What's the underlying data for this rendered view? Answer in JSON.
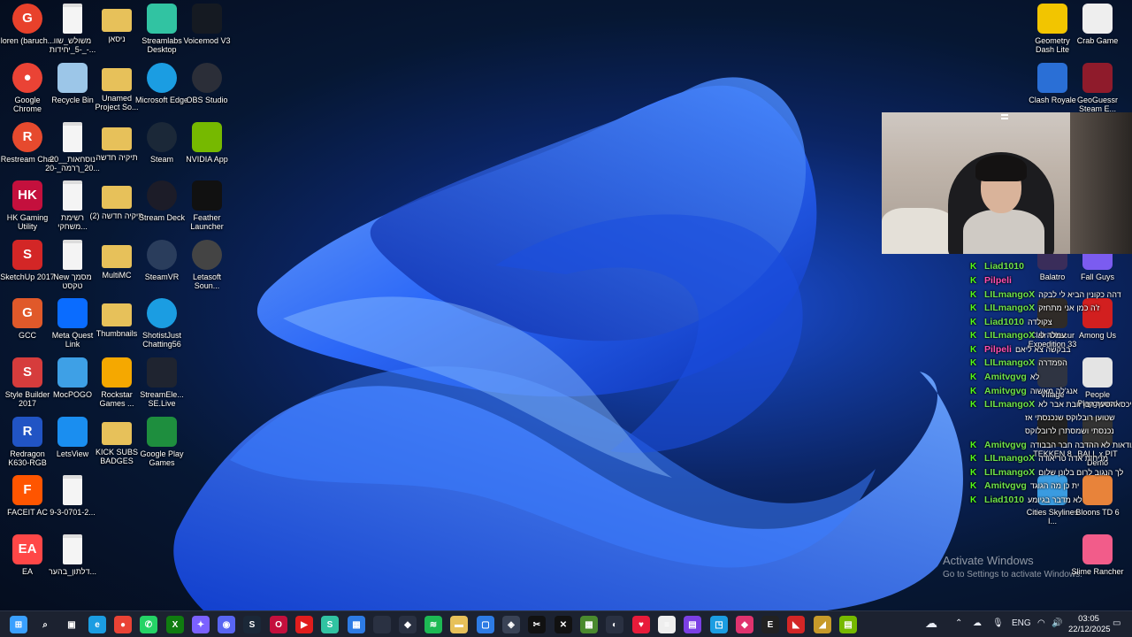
{
  "desktop_icons": [
    {
      "label": "loren (baruch...",
      "color": "#e8412b"
    },
    {
      "label": "Google Chrome",
      "color": "#ea4335"
    },
    {
      "label": "Restream Chat",
      "color": "#e64a2e"
    },
    {
      "label": "HK Gaming Utility",
      "color": "#c4103d"
    },
    {
      "label": "SketchUp 2017",
      "color": "#d32626"
    },
    {
      "label": "GCC",
      "color": "#e0592a"
    },
    {
      "label": "Style Builder 2017",
      "color": "#d63c3c"
    },
    {
      "label": "Redragon K630-RGB",
      "color": "#2154c4"
    },
    {
      "label": "FACEIT AC",
      "color": "#ff5500"
    },
    {
      "label": "EA",
      "color": "#ff4747"
    },
    {
      "label": "משולש_שוו -5_יחידות_-...",
      "color": "#f4f4f4"
    },
    {
      "label": "Recycle Bin",
      "color": "#9cc6e8"
    },
    {
      "label": "20_נוסחאות_ 20_ךרמה_-20...",
      "color": "#f4f4f4"
    },
    {
      "label": "רשימת משחקי...",
      "color": "#f4f4f4"
    },
    {
      "label": "New מסמך טקסט",
      "color": "#f4f4f4"
    },
    {
      "label": "Meta Quest Link",
      "color": "#0a6cff"
    },
    {
      "label": "MocPOGO",
      "color": "#3ea0e6"
    },
    {
      "label": "LetsView",
      "color": "#1a8ef0"
    },
    {
      "label": "9-3-0701-2...",
      "color": "#f4f4f4"
    },
    {
      "label": "דלתון_בהער...",
      "color": "#f4f4f4"
    },
    {
      "label": "ניסאן",
      "color": "#e7c15a"
    },
    {
      "label": "Unamed Project So...",
      "color": "#e7c15a"
    },
    {
      "label": "תיקיה חדשה",
      "color": "#e7c15a"
    },
    {
      "label": "תיקיה חדשה (2)",
      "color": "#e7c15a"
    },
    {
      "label": "MultiMC",
      "color": "#e7c15a"
    },
    {
      "label": "Thumbnails",
      "color": "#e7c15a"
    },
    {
      "label": "Rockstar Games ...",
      "color": "#f5a800"
    },
    {
      "label": "KICK SUBS BADGES",
      "color": "#e7c15a"
    },
    {
      "label": "Streamlabs Desktop",
      "color": "#31c3a2"
    },
    {
      "label": "Microsoft Edge",
      "color": "#1b9de2"
    },
    {
      "label": "Steam",
      "color": "#1b2838"
    },
    {
      "label": "Stream Deck",
      "color": "#1c1c28"
    },
    {
      "label": "SteamVR",
      "color": "#2a3d5c"
    },
    {
      "label": "ShotistJust Chatting56",
      "color": "#1b9de2"
    },
    {
      "label": "StreamEle... SE.Live",
      "color": "#1f2430"
    },
    {
      "label": "Google Play Games",
      "color": "#1e8e3e"
    },
    {
      "label": "Voicemod V3",
      "color": "#151a22"
    },
    {
      "label": "OBS Studio",
      "color": "#2b2e38"
    },
    {
      "label": "NVIDIA App",
      "color": "#76b900"
    },
    {
      "label": "Feather Launcher",
      "color": "#111111"
    },
    {
      "label": "Letasoft Soun...",
      "color": "#444444"
    },
    {
      "label": "Geometry Dash Lite",
      "color": "#f2c500"
    },
    {
      "label": "Crab Game",
      "color": "#eeeeee"
    },
    {
      "label": "Clash Royale",
      "color": "#2a6fd6"
    },
    {
      "label": "GeoGuessr Steam E...",
      "color": "#8f1b2b"
    },
    {
      "label": "Balatro",
      "color": "#3a2d5a"
    },
    {
      "label": "Fall Guys",
      "color": "#7b5cf0"
    },
    {
      "label": "Clair Obscur Expedition 33",
      "color": "#2f2b28"
    },
    {
      "label": "Among Us",
      "color": "#d21f1f"
    },
    {
      "label": "Village",
      "color": "#2f3442"
    },
    {
      "label": "People Playground",
      "color": "#e4e4e4"
    },
    {
      "label": "TEKKEN 8",
      "color": "#222222"
    },
    {
      "label": "BALL x PIT Demo",
      "color": "#333333"
    },
    {
      "label": "Cities Skylines I...",
      "color": "#3a9be0"
    },
    {
      "label": "Bloons TD 6",
      "color": "#e8833a"
    },
    {
      "label": "Slime Rancher",
      "color": "#f25c8a"
    }
  ],
  "icon_glyphs": {
    "loren (baruch...": "G",
    "Google Chrome": "●",
    "Restream Chat": "R",
    "HK Gaming Utility": "HK",
    "SketchUp 2017": "S",
    "GCC": "G",
    "Style Builder 2017": "S",
    "Redragon K630-RGB": "R",
    "FACEIT AC": "F",
    "EA": "EA"
  },
  "chat": {
    "messages": [
      {
        "user": "Liad1010",
        "text": ""
      },
      {
        "user": "Pilpeli",
        "text": ""
      },
      {
        "user": "LILmangoX",
        "text": "דהה כקונין הביא לי לבקה"
      },
      {
        "user": "LILmangoX",
        "text": "ז'ה כמן אני מתחזק"
      },
      {
        "user": "Liad1010",
        "text": "צקולדה"
      },
      {
        "user": "LILmangoX",
        "text": "עמלה לי"
      },
      {
        "user": "Pilpeli",
        "text": "בבקשה צא ליאם"
      },
      {
        "user": "LILmangoX",
        "text": "הפמדרה"
      },
      {
        "user": "Amitvgvg",
        "text": "לא"
      },
      {
        "user": "Amitvgvg",
        "text": "אנג'לה מאשוה"
      },
      {
        "user": "LILmangoX",
        "text": "ניכסאהסעך רבן זובת אבר לא"
      },
      {
        "user": "Amitvgvg",
        "text": "אבודאות לא ההדבה חבר הבבודה"
      },
      {
        "user": "LILmangoX",
        "text": "מניחות אדה טריאודה"
      },
      {
        "user": "LILmangoX",
        "text": "לך הנגוב לרום בלונן שלום"
      },
      {
        "user": "Amitvgvg",
        "text": "ית כן מה הגוגד"
      },
      {
        "user": "Liad1010",
        "text": "לא מדבר בגיומע"
      }
    ],
    "continuation_1": "שטוען רובלוקס שנכנסתי אז",
    "continuation_2": "נכנסתי ושמסתרן לרובלוקס"
  },
  "watermark": {
    "line1": "Activate Windows",
    "line2": "Go to Settings to activate Windows."
  },
  "taskbar": {
    "lang": "ENG",
    "time": "03:05",
    "date": "22/12/2025",
    "apps": [
      {
        "name": "start-button",
        "color": "#3aa0ff",
        "glyph": "⊞"
      },
      {
        "name": "search-icon",
        "color": "transparent",
        "glyph": "⌕"
      },
      {
        "name": "task-view-icon",
        "color": "transparent",
        "glyph": "▣"
      },
      {
        "name": "edge-icon",
        "color": "#1b9de2",
        "glyph": "e"
      },
      {
        "name": "chrome-icon",
        "color": "#ea4335",
        "glyph": "●"
      },
      {
        "name": "whatsapp-icon",
        "color": "#25d366",
        "glyph": "✆"
      },
      {
        "name": "xbox-icon",
        "color": "#107c10",
        "glyph": "X"
      },
      {
        "name": "copilot-icon",
        "color": "#7b61ff",
        "glyph": "✦"
      },
      {
        "name": "discord-icon",
        "color": "#5865f2",
        "glyph": "◉"
      },
      {
        "name": "steam-icon",
        "color": "#1b2838",
        "glyph": "S"
      },
      {
        "name": "opera-icon",
        "color": "#c4103d",
        "glyph": "O"
      },
      {
        "name": "youtube-icon",
        "color": "#e11d1d",
        "glyph": "▶"
      },
      {
        "name": "streamlabs-icon",
        "color": "#31c3a2",
        "glyph": "S"
      },
      {
        "name": "store-icon",
        "color": "#2d7be5",
        "glyph": "▦"
      },
      {
        "name": "blank-icon",
        "color": "#2a3142",
        "glyph": ""
      },
      {
        "name": "gear-app-icon",
        "color": "#2a3142",
        "glyph": "◆"
      },
      {
        "name": "spotify-icon",
        "color": "#1db954",
        "glyph": "≋"
      },
      {
        "name": "file-explorer-icon",
        "color": "#e7c15a",
        "glyph": "▬"
      },
      {
        "name": "photos-icon",
        "color": "#2d7be5",
        "glyph": "▢"
      },
      {
        "name": "shield-icon",
        "color": "#3a4356",
        "glyph": "◈"
      },
      {
        "name": "capcut-icon",
        "color": "#111111",
        "glyph": "✂"
      },
      {
        "name": "epic-x-icon",
        "color": "#111111",
        "glyph": "✕"
      },
      {
        "name": "minecraft-icon",
        "color": "#4a8a2e",
        "glyph": "▦"
      },
      {
        "name": "dark-app-icon",
        "color": "#2a3142",
        "glyph": "◐"
      },
      {
        "name": "heart-icon",
        "color": "#e81b3a",
        "glyph": "♥"
      },
      {
        "name": "notepad-icon",
        "color": "#eeeeee",
        "glyph": "≡"
      },
      {
        "name": "clapper-icon",
        "color": "#7b3fe4",
        "glyph": "▤"
      },
      {
        "name": "snip-icon",
        "color": "#1b9de2",
        "glyph": "◳"
      },
      {
        "name": "game-app-icon",
        "color": "#e0336e",
        "glyph": "◆"
      },
      {
        "name": "epic-games-icon",
        "color": "#222222",
        "glyph": "E"
      },
      {
        "name": "red-app-icon",
        "color": "#d32626",
        "glyph": "◣"
      },
      {
        "name": "gold-app-icon",
        "color": "#c79a2a",
        "glyph": "◢"
      },
      {
        "name": "nvidia-icon",
        "color": "#76b900",
        "glyph": "▤"
      },
      {
        "name": "obs-icon",
        "color": "#2b2e38",
        "glyph": "◎"
      }
    ]
  },
  "colors": {
    "chat_username": "#6ee24a",
    "chat_username_alt": "#ff4fb0",
    "kick_green": "#53fc18"
  }
}
